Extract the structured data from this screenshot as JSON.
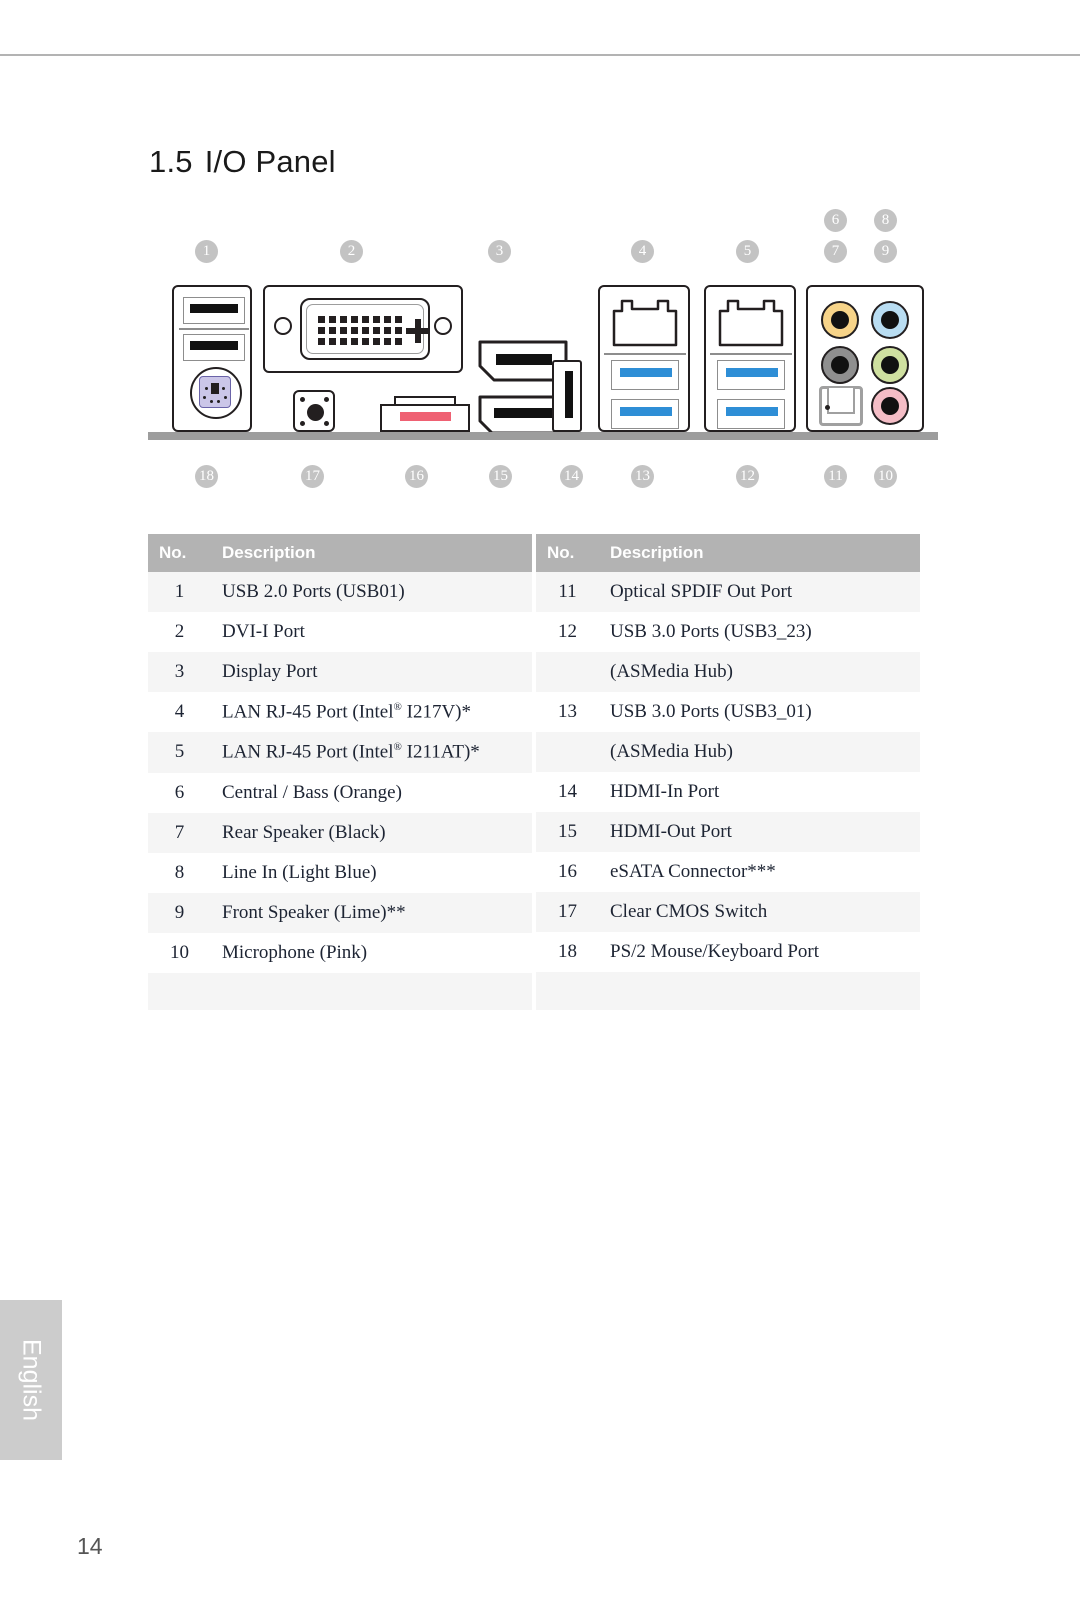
{
  "page": {
    "section_number": "1.5",
    "section_title": "I/O Panel",
    "page_number": "14",
    "language_tab": "English"
  },
  "diagram": {
    "top_callouts": [
      "1",
      "2",
      "3",
      "4",
      "5",
      "6",
      "7",
      "8",
      "9"
    ],
    "bottom_callouts": [
      "18",
      "17",
      "16",
      "15",
      "14",
      "13",
      "12",
      "11",
      "10"
    ],
    "colors": {
      "callout_bg": "#c3c3c3",
      "base_bar": "#9d9d9d",
      "outline": "#231f20",
      "usb3_blue": "#2e8ed6",
      "esata_red": "#ef6173",
      "ps2_purple": "#cbc6e8",
      "jack_orange": "#f7d489",
      "jack_lightblue": "#b9ddf2",
      "jack_black": "#8f8f8f",
      "jack_lime": "#cfe0a0",
      "jack_pink": "#f4bdc6",
      "spdif_grey": "#a0a0a0"
    },
    "ports": [
      {
        "callout": "1",
        "name": "usb-2-0-ports"
      },
      {
        "callout": "2",
        "name": "dvi-i-port"
      },
      {
        "callout": "3",
        "name": "display-port"
      },
      {
        "callout": "4",
        "name": "lan-rj45-port-1"
      },
      {
        "callout": "5",
        "name": "lan-rj45-port-2"
      },
      {
        "callout": "6",
        "name": "central-bass-jack"
      },
      {
        "callout": "7",
        "name": "rear-speaker-jack"
      },
      {
        "callout": "8",
        "name": "line-in-jack"
      },
      {
        "callout": "9",
        "name": "front-speaker-jack"
      },
      {
        "callout": "10",
        "name": "microphone-jack"
      },
      {
        "callout": "11",
        "name": "optical-spdif-out-port"
      },
      {
        "callout": "12",
        "name": "usb-3-0-ports-usb3-23"
      },
      {
        "callout": "13",
        "name": "usb-3-0-ports-usb3-01"
      },
      {
        "callout": "14",
        "name": "hdmi-in-port"
      },
      {
        "callout": "15",
        "name": "hdmi-out-port"
      },
      {
        "callout": "16",
        "name": "esata-connector"
      },
      {
        "callout": "17",
        "name": "clear-cmos-switch"
      },
      {
        "callout": "18",
        "name": "ps2-mouse-keyboard-port"
      }
    ]
  },
  "tables": {
    "headers": {
      "no": "No.",
      "description": "Description"
    },
    "left_rows": [
      {
        "no": "1",
        "description": "USB 2.0 Ports (USB01)"
      },
      {
        "no": "2",
        "description": "DVI-I Port"
      },
      {
        "no": "3",
        "description": "Display Port"
      },
      {
        "no": "4",
        "description": "LAN RJ-45 Port (Intel® I217V)*"
      },
      {
        "no": "5",
        "description": "LAN RJ-45 Port (Intel® I211AT)*"
      },
      {
        "no": "6",
        "description": "Central / Bass (Orange)"
      },
      {
        "no": "7",
        "description": "Rear Speaker (Black)"
      },
      {
        "no": "8",
        "description": "Line In (Light Blue)"
      },
      {
        "no": "9",
        "description": "Front Speaker (Lime)**"
      },
      {
        "no": "10",
        "description": "Microphone (Pink)"
      },
      {
        "no": "",
        "description": ""
      },
      {
        "no": "",
        "description": ""
      }
    ],
    "right_rows": [
      {
        "no": "11",
        "description": "Optical SPDIF Out Port"
      },
      {
        "no": "12",
        "description": "USB 3.0 Ports (USB3_23)"
      },
      {
        "no": "",
        "description": "(ASMedia Hub)"
      },
      {
        "no": "13",
        "description": "USB 3.0 Ports (USB3_01)"
      },
      {
        "no": "",
        "description": "(ASMedia Hub)"
      },
      {
        "no": "14",
        "description": "HDMI-In Port"
      },
      {
        "no": "15",
        "description": "HDMI-Out Port"
      },
      {
        "no": "16",
        "description": "eSATA Connector***"
      },
      {
        "no": "17",
        "description": "Clear CMOS Switch"
      },
      {
        "no": "18",
        "description": "PS/2 Mouse/Keyboard Port"
      },
      {
        "no": "",
        "description": ""
      },
      {
        "no": "",
        "description": ""
      }
    ]
  }
}
